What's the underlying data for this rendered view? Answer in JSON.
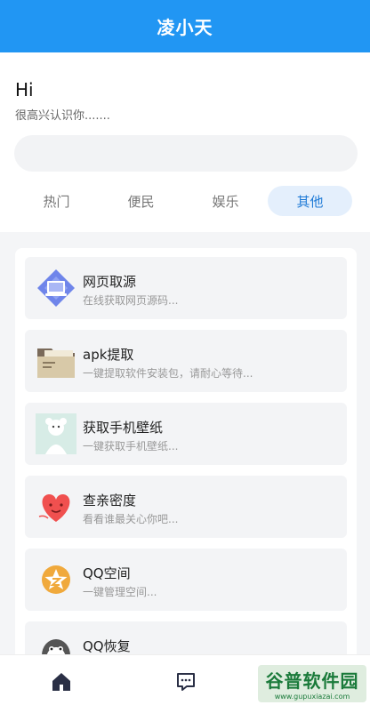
{
  "header": {
    "title": "凌小天"
  },
  "hero": {
    "greeting": "Hi",
    "subtitle": "很高兴认识你.......",
    "search_placeholder": ""
  },
  "tabs": [
    {
      "label": "热门"
    },
    {
      "label": "便民"
    },
    {
      "label": "娱乐"
    },
    {
      "label": "其他",
      "active": true
    }
  ],
  "items": [
    {
      "title": "网页取源",
      "desc": "在线获取网页源码...",
      "icon": "web-source-icon"
    },
    {
      "title": "apk提取",
      "desc": "一键提取软件安装包，请耐心等待...",
      "icon": "folder-icon"
    },
    {
      "title": "获取手机壁纸",
      "desc": "一键获取手机壁纸...",
      "icon": "wallpaper-icon"
    },
    {
      "title": "查亲密度",
      "desc": "看看谁最关心你吧...",
      "icon": "heart-icon"
    },
    {
      "title": "QQ空间",
      "desc": "一键管理空间...",
      "icon": "qzone-star-icon"
    },
    {
      "title": "QQ恢复",
      "desc": "",
      "icon": "penguin-icon"
    }
  ],
  "bottom_nav": [
    {
      "icon": "home-icon"
    },
    {
      "icon": "message-icon"
    }
  ],
  "watermark": {
    "main": "谷普软件园",
    "sub": "www.gupuxiazai.com"
  },
  "colors": {
    "primary": "#2196f3",
    "tab_active_bg": "#e4effc",
    "tab_active_text": "#1e7ad6"
  }
}
